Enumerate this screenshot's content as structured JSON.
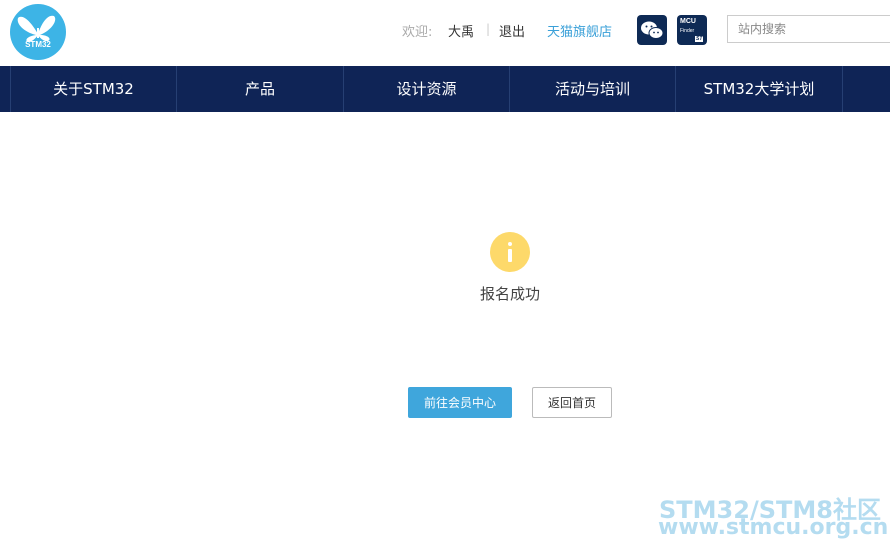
{
  "header": {
    "logo_text": "STM32",
    "welcome_label": "欢迎:",
    "username": "大禹",
    "separator": "|",
    "logout_label": "退出",
    "tmall_label": "天猫旗舰店",
    "mcu_icon": {
      "line1": "MCU",
      "line2": "Finder",
      "brand": "ST"
    },
    "search": {
      "placeholder": "站内搜索",
      "value": ""
    }
  },
  "nav": {
    "items": [
      {
        "label": "关于STM32"
      },
      {
        "label": "产品"
      },
      {
        "label": "设计资源"
      },
      {
        "label": "活动与培训"
      },
      {
        "label": "STM32大学计划"
      }
    ]
  },
  "main": {
    "message": "报名成功",
    "primary_button": "前往会员中心",
    "secondary_button": "返回首页"
  },
  "watermark": {
    "line1": "STM32/STM8社区",
    "line2": "www.stmcu.org.cn"
  },
  "colors": {
    "nav_bg": "#0f2456",
    "accent": "#3fa6dc",
    "info_icon": "#fdd96a",
    "logo": "#3db4e6"
  }
}
